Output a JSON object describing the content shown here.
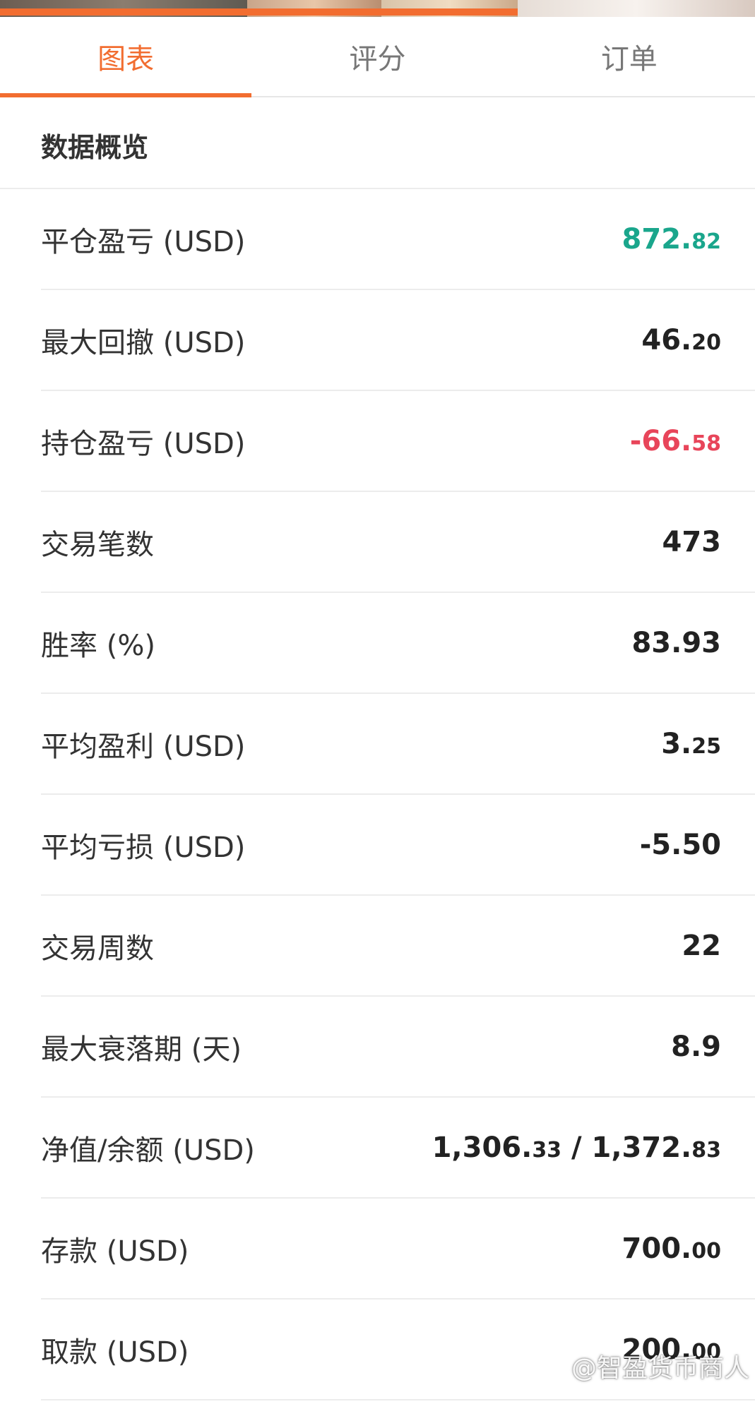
{
  "tabs": [
    {
      "label": "图表",
      "active": true
    },
    {
      "label": "评分",
      "active": false
    },
    {
      "label": "订单",
      "active": false
    }
  ],
  "section": {
    "title": "数据概览"
  },
  "colors": {
    "accent": "#f26d30",
    "positive": "#1aa68c",
    "negative": "#e8455a"
  },
  "stats": [
    {
      "label": "平仓盈亏 (USD)",
      "int": "872.",
      "dec": "82",
      "tone": "pos"
    },
    {
      "label": "最大回撤 (USD)",
      "int": "46.",
      "dec": "20",
      "tone": ""
    },
    {
      "label": "持仓盈亏 (USD)",
      "int": "-66.",
      "dec": "58",
      "tone": "neg"
    },
    {
      "label": "交易笔数",
      "int": "473",
      "dec": "",
      "tone": ""
    },
    {
      "label": "胜率 (%)",
      "int": "83.93",
      "dec": "",
      "tone": ""
    },
    {
      "label": "平均盈利 (USD)",
      "int": "3.",
      "dec": "25",
      "tone": ""
    },
    {
      "label": "平均亏损 (USD)",
      "int": "-5.50",
      "dec": "",
      "tone": ""
    },
    {
      "label": "交易周数",
      "int": "22",
      "dec": "",
      "tone": ""
    },
    {
      "label": "最大衰落期 (天)",
      "int": "8.9",
      "dec": "",
      "tone": ""
    },
    {
      "label": "净值/余额 (USD)",
      "int": "1,306.",
      "dec": "33",
      "int2": " / 1,372.",
      "dec2": "83",
      "tone": ""
    },
    {
      "label": "存款 (USD)",
      "int": "700.",
      "dec": "00",
      "tone": ""
    },
    {
      "label": "取款 (USD)",
      "int": "200.",
      "dec": "00",
      "tone": ""
    }
  ],
  "watermark": {
    "text": "@智盈货币商人",
    "icon": "snowball-logo-icon"
  }
}
